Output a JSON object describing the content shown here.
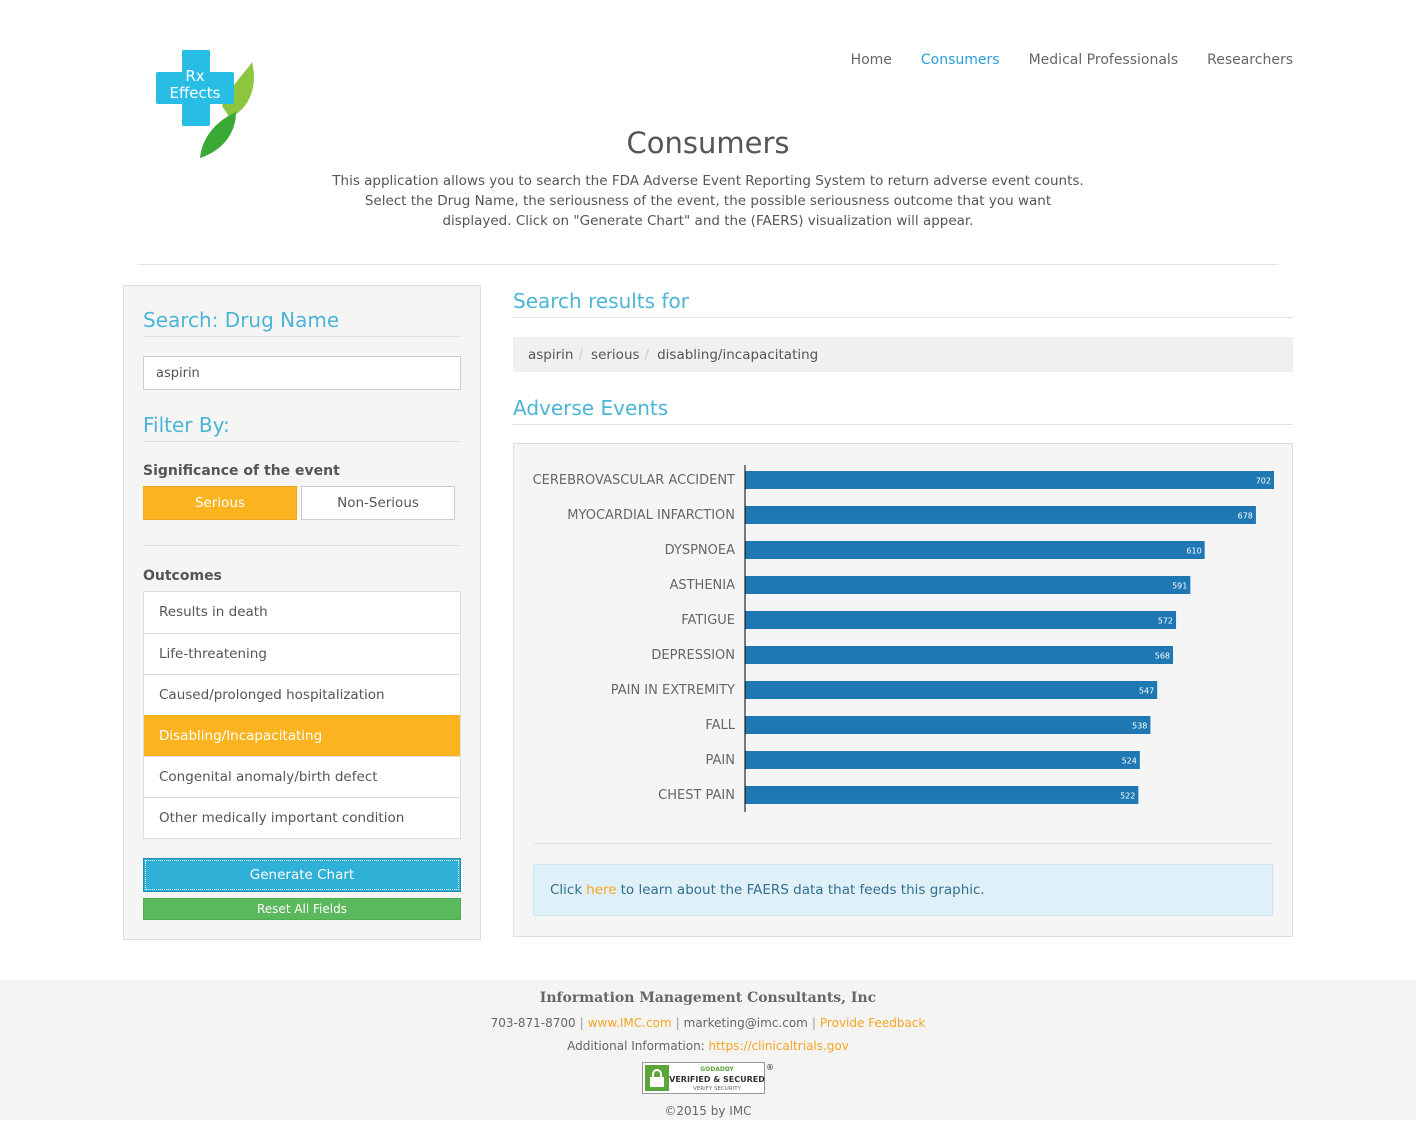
{
  "brand": {
    "logo_text_line1": "Rx",
    "logo_text_line2": "Effects"
  },
  "nav": {
    "items": [
      {
        "label": "Home",
        "active": false
      },
      {
        "label": "Consumers",
        "active": true
      },
      {
        "label": "Medical Professionals",
        "active": false
      },
      {
        "label": "Researchers",
        "active": false
      }
    ]
  },
  "page": {
    "title": "Consumers",
    "intro": "This application allows you to search the FDA Adverse Event Reporting System to return adverse event counts. Select the Drug Name, the seriousness of the event, the possible seriousness outcome that you want displayed. Click on \"Generate Chart\" and the (FAERS) visualization will appear."
  },
  "sidebar": {
    "search_heading": "Search: Drug Name",
    "drug_value": "aspirin",
    "filter_heading": "Filter By:",
    "significance_label": "Significance of the event",
    "serious_label": "Serious",
    "non_serious_label": "Non-Serious",
    "outcomes_label": "Outcomes",
    "outcomes": [
      {
        "label": "Results in death",
        "selected": false
      },
      {
        "label": "Life-threatening",
        "selected": false
      },
      {
        "label": "Caused/prolonged hospitalization",
        "selected": false
      },
      {
        "label": "Disabling/Incapacitating",
        "selected": true
      },
      {
        "label": "Congenital anomaly/birth defect",
        "selected": false
      },
      {
        "label": "Other medically important condition",
        "selected": false
      }
    ],
    "generate_label": "Generate Chart",
    "reset_label": "Reset All Fields"
  },
  "results": {
    "heading": "Search results for",
    "breadcrumb": [
      "aspirin",
      "serious",
      "disabling/incapacitating"
    ],
    "breadcrumb_sep": "/",
    "events_heading": "Adverse Events",
    "info_prefix": "Click",
    "info_link": "here",
    "info_suffix": "to learn about the FAERS data that feeds this graphic."
  },
  "chart_data": {
    "type": "bar",
    "orientation": "horizontal",
    "categories": [
      "CEREBROVASCULAR ACCIDENT",
      "MYOCARDIAL INFARCTION",
      "DYSPNOEA",
      "ASTHENIA",
      "FATIGUE",
      "DEPRESSION",
      "PAIN IN EXTREMITY",
      "FALL",
      "PAIN",
      "CHEST PAIN"
    ],
    "values": [
      702,
      678,
      610,
      591,
      572,
      568,
      547,
      538,
      524,
      522
    ],
    "bar_color": "#1f77b4",
    "xlim": [
      0,
      702
    ]
  },
  "footer": {
    "company": "Information Management Consultants, Inc",
    "phone": "703-871-8700",
    "website": "www.IMC.com",
    "email": "marketing@imc.com",
    "feedback": "Provide Feedback",
    "additional_label": "Additional Information:",
    "additional_link": "https://clinicaltrials.gov",
    "seal_top": "GODADDY",
    "seal_mid": "VERIFIED & SECURED",
    "seal_bottom": "VERIFY SECURITY",
    "copyright": "©2015 by IMC"
  }
}
